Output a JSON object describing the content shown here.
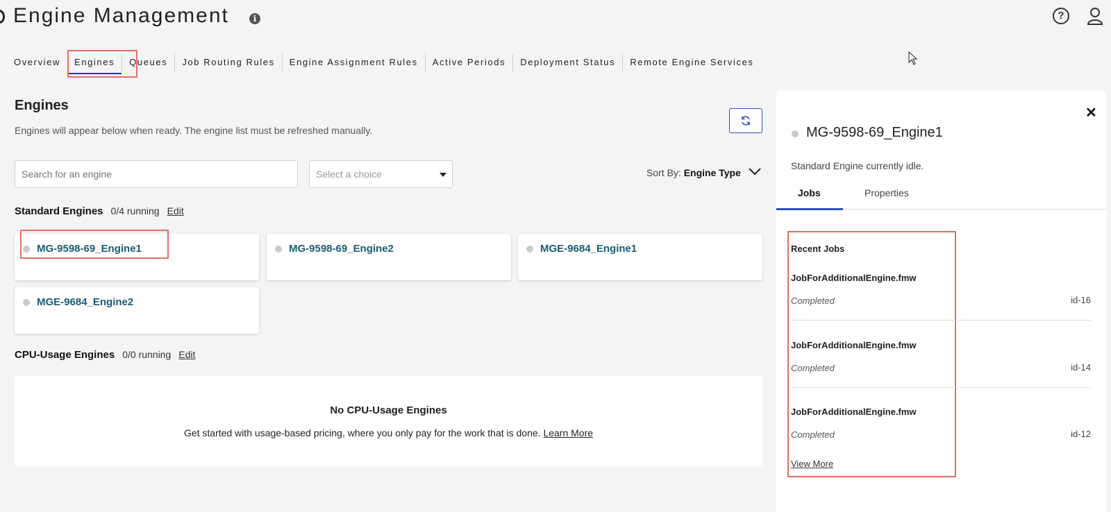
{
  "header": {
    "title": "Engine Management",
    "info_icon": "info-icon",
    "help_icon": "help-icon",
    "user_icon": "user-icon"
  },
  "nav": {
    "tabs": [
      {
        "label": "Overview"
      },
      {
        "label": "Engines",
        "active": true
      },
      {
        "label": "Queues"
      },
      {
        "label": "Job Routing Rules"
      },
      {
        "label": "Engine Assignment Rules"
      },
      {
        "label": "Active Periods"
      },
      {
        "label": "Deployment Status"
      },
      {
        "label": "Remote Engine Services"
      }
    ]
  },
  "engines": {
    "title": "Engines",
    "subtitle": "Engines will appear below when ready. The engine list must be refreshed manually.",
    "search_placeholder": "Search for an engine",
    "select_placeholder": "Select a choice",
    "sort_label": "Sort By:",
    "sort_value": "Engine Type",
    "standard": {
      "name": "Standard Engines",
      "count": "0/4 running",
      "edit_label": "Edit",
      "cards": [
        {
          "name": "MG-9598-69_Engine1"
        },
        {
          "name": "MG-9598-69_Engine2"
        },
        {
          "name": "MGE-9684_Engine1"
        },
        {
          "name": "MGE-9684_Engine2"
        }
      ]
    },
    "cpu": {
      "name": "CPU-Usage Engines",
      "count": "0/0 running",
      "edit_label": "Edit",
      "empty_title": "No CPU-Usage Engines",
      "empty_text": "Get started with usage-based pricing, where you only pay for the work that is done.",
      "learn_more": "Learn More"
    }
  },
  "panel": {
    "engine_name": "MG-9598-69_Engine1",
    "status_text": "Standard Engine currently idle.",
    "tabs": [
      {
        "label": "Jobs",
        "active": true
      },
      {
        "label": "Properties"
      }
    ],
    "recent_jobs_title": "Recent Jobs",
    "jobs": [
      {
        "name": "JobForAdditionalEngine.fmw",
        "status": "Completed",
        "id": "id-16"
      },
      {
        "name": "JobForAdditionalEngine.fmw",
        "status": "Completed",
        "id": "id-14"
      },
      {
        "name": "JobForAdditionalEngine.fmw",
        "status": "Completed",
        "id": "id-12"
      }
    ],
    "view_more": "View More"
  },
  "colors": {
    "background": "#f4f4f4",
    "engine_link": "#1b5a73",
    "accent": "#2e4fbf",
    "highlight_box": "#e07060",
    "idle_dot": "#c9c9c9"
  }
}
